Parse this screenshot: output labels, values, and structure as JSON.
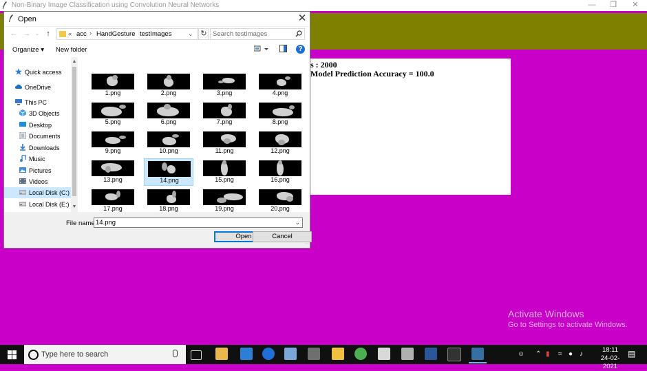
{
  "app": {
    "title": "Non-Binary Image Classification using Convolution Neural Networks",
    "result_line1": "s : 2000",
    "result_line2": "Model Prediction Accuracy = 100.0",
    "bg_color": "#c800c8",
    "band_color": "#808000"
  },
  "dialog": {
    "title": "Open",
    "breadcrumb": [
      "«",
      "acc",
      "HandGesture",
      "testImages"
    ],
    "search_placeholder": "Search testImages",
    "toolbar": {
      "organize": "Organize",
      "new_folder": "New folder"
    },
    "nav_items": [
      {
        "label": "Quick access",
        "icon": "star-icon",
        "color": "#2e7bd6"
      },
      {
        "label": "OneDrive",
        "icon": "cloud-icon",
        "color": "#1a73c7"
      },
      {
        "label": "This PC",
        "icon": "computer-icon",
        "color": "#3b79c4"
      },
      {
        "label": "3D Objects",
        "icon": "cube-icon",
        "color": "#4aa0e0"
      },
      {
        "label": "Desktop",
        "icon": "desktop-icon",
        "color": "#1e8fd8"
      },
      {
        "label": "Documents",
        "icon": "document-icon",
        "color": "#6b7b8c"
      },
      {
        "label": "Downloads",
        "icon": "download-icon",
        "color": "#2a78d0"
      },
      {
        "label": "Music",
        "icon": "music-icon",
        "color": "#3b7fd2"
      },
      {
        "label": "Pictures",
        "icon": "pictures-icon",
        "color": "#3e8fd6"
      },
      {
        "label": "Videos",
        "icon": "video-icon",
        "color": "#5b6f86"
      },
      {
        "label": "Local Disk (C:)",
        "icon": "drive-icon",
        "color": "#6d6d6d"
      },
      {
        "label": "Local Disk (E:)",
        "icon": "drive-icon",
        "color": "#6d6d6d"
      }
    ],
    "files": [
      "1.png",
      "2.png",
      "3.png",
      "4.png",
      "5.png",
      "6.png",
      "7.png",
      "8.png",
      "9.png",
      "10.png",
      "11.png",
      "12.png",
      "13.png",
      "14.png",
      "15.png",
      "16.png",
      "17.png",
      "18.png",
      "19.png",
      "20.png"
    ],
    "selected_file": "14.png",
    "file_name_label": "File name:",
    "file_name_value": "14.png",
    "open_label": "Open",
    "cancel_label": "Cancel"
  },
  "activation": {
    "line1": "Activate Windows",
    "line2": "Go to Settings to activate Windows."
  },
  "taskbar": {
    "search_placeholder": "Type here to search",
    "time": "18:11",
    "date": "24-02-2021"
  }
}
